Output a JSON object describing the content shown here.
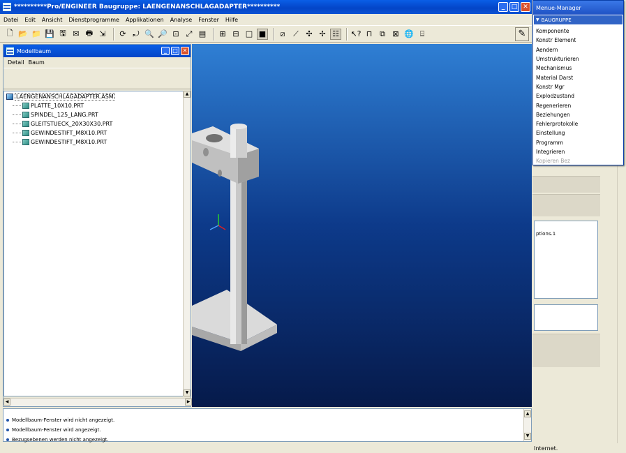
{
  "main_window": {
    "title": "**********Pro/ENGINEER Baugruppe: LAENGENANSCHLAGADAPTER**********",
    "menu": [
      "Datei",
      "Edit",
      "Ansicht",
      "Dienstprogramme",
      "Applikationen",
      "Analyse",
      "Fenster",
      "Hilfe"
    ]
  },
  "model_tree": {
    "title": "Modellbaum",
    "menu": [
      "Detail",
      "Baum"
    ],
    "items": [
      {
        "label": "LAENGENANSCHLAGADAPTER.ASM",
        "type": "asm"
      },
      {
        "label": "PLATTE_10X10.PRT",
        "type": "prt"
      },
      {
        "label": "SPINDEL_125_LANG.PRT",
        "type": "prt"
      },
      {
        "label": "GLEITSTUECK_20X30X30.PRT",
        "type": "prt"
      },
      {
        "label": "GEWINDESTIFT_M8X10.PRT",
        "type": "prt"
      },
      {
        "label": "GEWINDESTIFT_M8X10.PRT",
        "type": "prt"
      }
    ]
  },
  "messages": [
    "Modellbaum-Fenster wird nicht angezeigt.",
    "Modellbaum-Fenster wird angezeigt.",
    "Bezugsebenen werden nicht angezeigt."
  ],
  "menu_manager": {
    "title": "Menue-Manager",
    "header": "BAUGRUPPE",
    "items": [
      {
        "label": "Komponente",
        "enabled": true
      },
      {
        "label": "Konstr Element",
        "enabled": true
      },
      {
        "label": "Aendern",
        "enabled": true
      },
      {
        "label": "Umstrukturieren",
        "enabled": true
      },
      {
        "label": "Mechanismus",
        "enabled": true
      },
      {
        "label": "Material Darst",
        "enabled": true
      },
      {
        "label": "Konstr Mgr",
        "enabled": true
      },
      {
        "label": "Explodzustand",
        "enabled": true
      },
      {
        "label": "Regenerieren",
        "enabled": true
      },
      {
        "label": "Beziehungen",
        "enabled": true
      },
      {
        "label": "Fehlerprotokolle",
        "enabled": true
      },
      {
        "label": "Einstellung",
        "enabled": true
      },
      {
        "label": "Programm",
        "enabled": true
      },
      {
        "label": "Integrieren",
        "enabled": true
      },
      {
        "label": "Kopieren Bez",
        "enabled": false
      }
    ]
  },
  "right_panel": {
    "fragment_text": "ptions.1",
    "status_fragment": "Internet."
  },
  "colors": {
    "titlebar": "#0345c7",
    "viewport_top": "#2f7fd4",
    "viewport_bottom": "#061a4a"
  }
}
